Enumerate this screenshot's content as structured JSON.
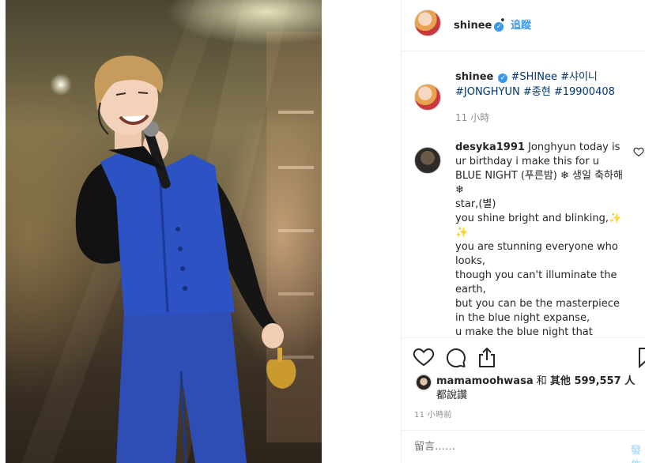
{
  "post": {
    "username": "shinee",
    "follow_label": "追蹤",
    "separator": "•"
  },
  "caption": {
    "username": "shinee",
    "tags": [
      "#SHINee",
      "#샤이니",
      "#JONGHYUN",
      "#종현",
      "#19900408"
    ],
    "time": "11 小時"
  },
  "comment": {
    "username": "desyka1991",
    "text": "Jonghyun today is ur birthday i make this for u\nBLUE NIGHT (푸른밤) ❄ 생일 축하해 ❄\nstar,(별)\nyou shine bright and blinking,✨ ✨\nyou are stunning everyone who looks,\nthough you can't illuminate the earth,\nbut you can be the masterpiece in the blue night expanse,\nu make the blue night that"
  },
  "likes": {
    "liker": "mamamoohwasa",
    "connector": "和",
    "others_label": "其他",
    "count": "599,557",
    "suffix": "人",
    "end": "都說讚",
    "time": "11 小時前"
  },
  "composer": {
    "placeholder": "留言……",
    "post_label": "發佈"
  },
  "icons": {
    "verified": "verified-badge-icon",
    "like": "heart-icon",
    "comment": "comment-bubble-icon",
    "share": "share-icon",
    "save": "bookmark-icon"
  },
  "colors": {
    "link": "#3897f0",
    "hashtag": "#003569",
    "muted": "#8e8e8e"
  }
}
